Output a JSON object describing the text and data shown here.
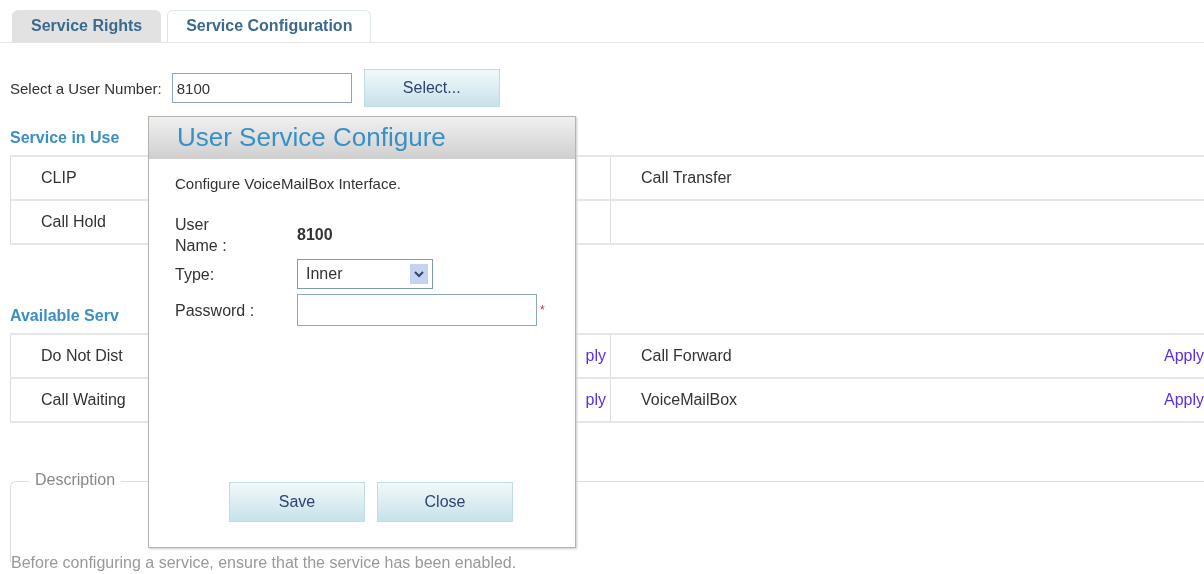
{
  "tabs": [
    {
      "label": "Service Rights",
      "selected": false
    },
    {
      "label": "Service Configuration",
      "selected": true
    }
  ],
  "user_number": {
    "label": "Select a User Number:",
    "value": "8100",
    "button": "Select..."
  },
  "services_in_use": {
    "title": "Service in Use",
    "rows": [
      {
        "cells": [
          "CLIP",
          "Call Transfer"
        ]
      },
      {
        "cells": [
          "Call Hold"
        ]
      }
    ]
  },
  "available_services": {
    "title": "Available Serv",
    "rows": [
      {
        "cells": [
          {
            "name": "Do Not Dist",
            "action": "ply"
          },
          {
            "name": "Call Forward",
            "action": "Apply"
          }
        ]
      },
      {
        "cells": [
          {
            "name": "Call Waiting",
            "action": "ply"
          },
          {
            "name": "VoiceMailBox",
            "action": "Apply"
          }
        ]
      }
    ]
  },
  "description": {
    "legend": "Description",
    "text": "Before configuring a service, ensure that the service has been enabled."
  },
  "dialog": {
    "title": "User Service Configure",
    "intro": "Configure VoiceMailBox Interface.",
    "fields": [
      {
        "kind": "static",
        "label": "User Name :",
        "value": "8100"
      },
      {
        "kind": "select",
        "label": "Type:",
        "value": "Inner"
      },
      {
        "kind": "password",
        "label": "Password :",
        "required_mark": "*"
      }
    ],
    "buttons": [
      "Save",
      "Close"
    ]
  }
}
